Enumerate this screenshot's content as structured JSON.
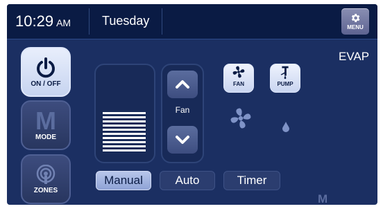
{
  "header": {
    "time": "10:29",
    "ampm": "AM",
    "day": "Tuesday",
    "menu_label": "MENU",
    "menu_icon": "gear-icon"
  },
  "mode_display": "EVAP",
  "side_buttons": {
    "power": {
      "label": "ON / OFF",
      "icon": "power-icon"
    },
    "mode": {
      "label": "MODE",
      "letter": "M"
    },
    "zones": {
      "label": "ZONES",
      "icon": "zones-icon"
    }
  },
  "fan_control": {
    "label": "Fan",
    "level_bars": 10,
    "up_icon": "chevron-up-icon",
    "down_icon": "chevron-down-icon"
  },
  "toggles": {
    "fan": {
      "label": "FAN",
      "icon": "fan-icon"
    },
    "pump": {
      "label": "PUMP",
      "icon": "pump-icon"
    }
  },
  "status_icons": [
    "fan-status-icon",
    "water-drop-icon"
  ],
  "tabs": [
    {
      "label": "Manual",
      "active": true
    },
    {
      "label": "Auto",
      "active": false
    },
    {
      "label": "Timer",
      "active": false
    }
  ],
  "footer": {
    "mode_letter": "M"
  },
  "colors": {
    "panel": "#1b2f62",
    "topbar": "#0a1b44",
    "accent": "#b7c6ea"
  }
}
